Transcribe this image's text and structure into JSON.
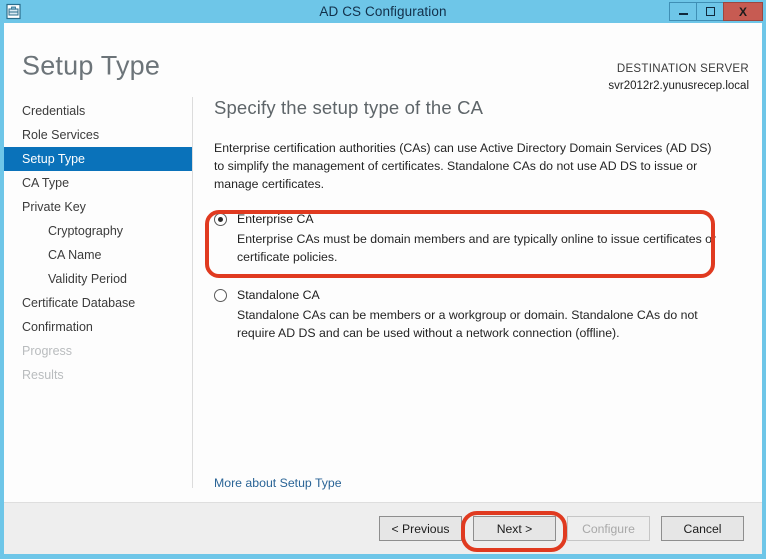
{
  "window": {
    "title": "AD CS Configuration",
    "icon": "certificate-server-icon",
    "accent_border": "#6ec6e8",
    "controls": {
      "minimize": "minimize-icon",
      "maximize": "maximize-icon",
      "close_label": "X",
      "close_color": "#c75b52"
    }
  },
  "header": {
    "page_title": "Setup Type",
    "destination_label": "DESTINATION SERVER",
    "destination_value": "svr2012r2.yunusrecep.local"
  },
  "sidebar": {
    "active_color": "#0a72ba",
    "items": [
      {
        "label": "Credentials",
        "state": "enabled",
        "indent": false
      },
      {
        "label": "Role Services",
        "state": "enabled",
        "indent": false
      },
      {
        "label": "Setup Type",
        "state": "active",
        "indent": false
      },
      {
        "label": "CA Type",
        "state": "enabled",
        "indent": false
      },
      {
        "label": "Private Key",
        "state": "enabled",
        "indent": false
      },
      {
        "label": "Cryptography",
        "state": "enabled",
        "indent": true
      },
      {
        "label": "CA Name",
        "state": "enabled",
        "indent": true
      },
      {
        "label": "Validity Period",
        "state": "enabled",
        "indent": true
      },
      {
        "label": "Certificate Database",
        "state": "enabled",
        "indent": false
      },
      {
        "label": "Confirmation",
        "state": "enabled",
        "indent": false
      },
      {
        "label": "Progress",
        "state": "disabled",
        "indent": false
      },
      {
        "label": "Results",
        "state": "disabled",
        "indent": false
      }
    ]
  },
  "content": {
    "title": "Specify the setup type of the CA",
    "description": "Enterprise certification authorities (CAs) can use Active Directory Domain Services (AD DS) to simplify the management of certificates. Standalone CAs do not use AD DS to issue or manage certificates.",
    "options": [
      {
        "label": "Enterprise CA",
        "selected": true,
        "description": "Enterprise CAs must be domain members and are typically online to issue certificates or certificate policies."
      },
      {
        "label": "Standalone CA",
        "selected": false,
        "description": "Standalone CAs can be members or a workgroup or domain. Standalone CAs do not require AD DS and can be used without a network connection (offline)."
      }
    ],
    "more_link": "More about Setup Type"
  },
  "footer": {
    "buttons": [
      {
        "label": "< Previous",
        "state": "enabled"
      },
      {
        "label": "Next >",
        "state": "enabled"
      },
      {
        "label": "Configure",
        "state": "disabled"
      },
      {
        "label": "Cancel",
        "state": "enabled"
      }
    ]
  },
  "annotations": {
    "color": "#e03a20",
    "targets": [
      "enterprise-ca-option",
      "next-button"
    ]
  }
}
